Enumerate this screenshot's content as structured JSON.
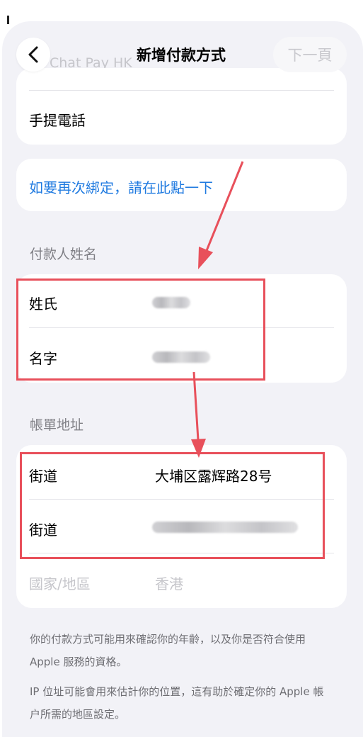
{
  "header": {
    "title": "新增付款方式",
    "next_label": "下一頁",
    "ghost_text": "Chat Pay HK"
  },
  "top_card": {
    "phone_label": "手提電話"
  },
  "rebind_card": {
    "link_text": "如要再次綁定，請在此點一下"
  },
  "payer_section": {
    "header": "付款人姓名",
    "surname_label": "姓氏",
    "given_name_label": "名字"
  },
  "billing_section": {
    "header": "帳單地址",
    "street1_label": "街道",
    "street1_value": "大埔区露辉路28号",
    "street2_label": "街道",
    "country_label": "國家/地區",
    "country_value": "香港"
  },
  "footer": {
    "note1": "你的付款方式可能用來確認你的年齡，以及你是否符合使用 Apple 服務的資格。",
    "note2": "IP 位址可能會用來估計你的位置，這有助於確定你的 Apple 帳户所需的地區設定。"
  },
  "colors": {
    "accent_link": "#1f7ae0",
    "annotation_red": "#e8505b",
    "background": "#f2f2f7"
  },
  "icons": {
    "back": "chevron-left-icon"
  }
}
